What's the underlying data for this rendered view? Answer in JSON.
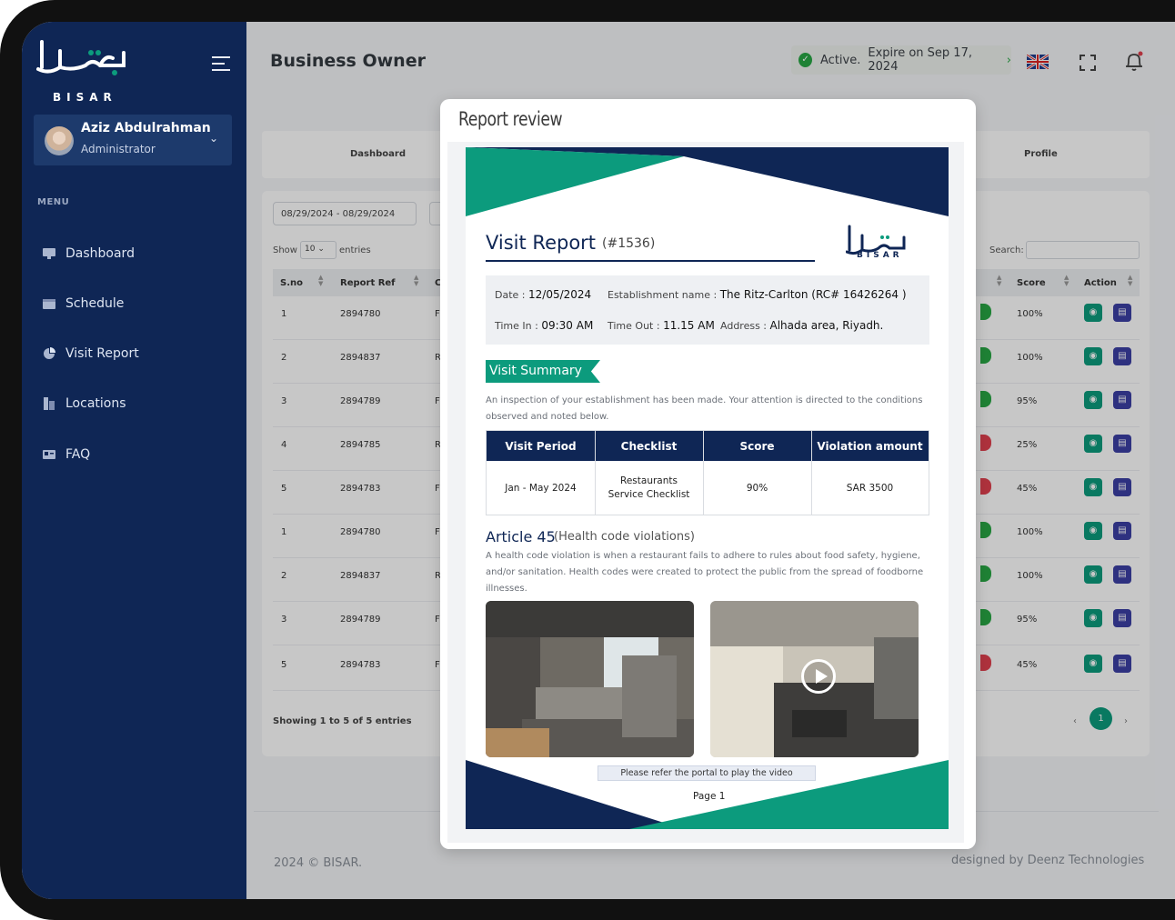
{
  "brand": {
    "logo_text": "BISAR",
    "logo_arabic": "بصار"
  },
  "user": {
    "name": "Aziz Abdulrahman",
    "role": "Administrator"
  },
  "menu": {
    "title": "MENU",
    "items": [
      {
        "label": "Dashboard",
        "icon": "dashboard-icon"
      },
      {
        "label": "Schedule",
        "icon": "calendar-icon"
      },
      {
        "label": "Visit Report",
        "icon": "pie-chart-icon"
      },
      {
        "label": "Locations",
        "icon": "location-icon"
      },
      {
        "label": "FAQ",
        "icon": "id-card-icon"
      }
    ]
  },
  "header": {
    "title": "Business Owner",
    "status": "Active.",
    "expiry": "Expire on Sep 17, 2024"
  },
  "tabs": {
    "dashboard": "Dashboard",
    "profile": "Profile"
  },
  "table": {
    "date_range": "08/29/2024 - 08/29/2024",
    "show_label": "Show",
    "page_size": "10",
    "entries_label": "entries",
    "search_label": "Search:",
    "columns": {
      "sno": "S.no",
      "report_ref": "Report Ref",
      "score": "Score",
      "action": "Action"
    },
    "rows": [
      {
        "sno": "1",
        "ref": "2894780",
        "c": "F",
        "score": "100%",
        "status_color": "#28a745"
      },
      {
        "sno": "2",
        "ref": "2894837",
        "c": "R",
        "score": "100%",
        "status_color": "#28a745"
      },
      {
        "sno": "3",
        "ref": "2894789",
        "c": "F",
        "score": "95%",
        "status_color": "#28a745"
      },
      {
        "sno": "4",
        "ref": "2894785",
        "c": "R",
        "score": "25%",
        "status_color": "#e0404f"
      },
      {
        "sno": "5",
        "ref": "2894783",
        "c": "F",
        "score": "45%",
        "status_color": "#e0404f"
      },
      {
        "sno": "1",
        "ref": "2894780",
        "c": "F",
        "score": "100%",
        "status_color": "#28a745"
      },
      {
        "sno": "2",
        "ref": "2894837",
        "c": "R",
        "score": "100%",
        "status_color": "#28a745"
      },
      {
        "sno": "3",
        "ref": "2894789",
        "c": "F",
        "score": "95%",
        "status_color": "#28a745"
      },
      {
        "sno": "5",
        "ref": "2894783",
        "c": "F",
        "score": "45%",
        "status_color": "#e0404f"
      }
    ],
    "showing": "Showing 1 to 5 of 5 entries",
    "page": "1"
  },
  "footer": {
    "copyright": "2024 © BISAR.",
    "credit": "designed by Deenz Technologies"
  },
  "modal": {
    "title": "Report review",
    "report": {
      "title": "Visit Report",
      "id": "(#1536)",
      "date_label": "Date :",
      "date": "12/05/2024",
      "establishment_label": "Establishment name :",
      "establishment": "The Ritz-Carlton (RC# 16426264 )",
      "time_in_label": "Time In :",
      "time_in": "09:30 AM",
      "time_out_label": "Time Out :",
      "time_out": "11.15 AM",
      "address_label": "Address :",
      "address": "Alhada area, Riyadh.",
      "summary_tag": "Visit Summary",
      "summary_desc": "An inspection of your establishment has been made. Your attention is directed to the conditions observed and noted below.",
      "summary_headers": [
        "Visit Period",
        "Checklist",
        "Score",
        "Violation amount"
      ],
      "summary_values": [
        "Jan - May 2024",
        "Restaurants Service Checklist",
        "90%",
        "SAR 3500"
      ],
      "article_title": "Article 45",
      "article_sub": "(Health code violations)",
      "article_desc": "A health code violation is when a restaurant fails to adhere to rules about food safety, hygiene, and/or sanitation. Health codes were created to protect the public from the spread of foodborne illnesses.",
      "video_note": "Please refer the portal to play the video",
      "page": "Page 1"
    }
  },
  "colors": {
    "navy": "#0f2655",
    "teal": "#0c9b7d",
    "accent_green": "#28a745"
  }
}
